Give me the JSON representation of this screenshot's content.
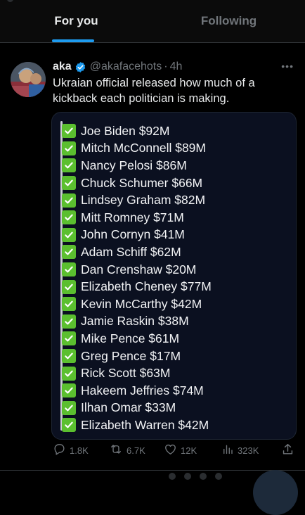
{
  "tabs": {
    "for_you": "For you",
    "following": "Following"
  },
  "tweet": {
    "display_name": "aka",
    "handle": "@akafacehots",
    "separator": "·",
    "time": "4h",
    "text": "Ukraian official released how much of a kickback each politician is making.",
    "more_label": "•••",
    "media_list": [
      "Joe Biden $92M",
      "Mitch McConnell $89M",
      "Nancy Pelosi $86M",
      "Chuck Schumer $66M",
      "Lindsey Graham $82M",
      "Mitt Romney $71M",
      "John Cornyn $41M",
      "Adam Schiff $62M",
      "Dan Crenshaw $20M",
      "Elizabeth Cheney $77M",
      "Kevin McCarthy $42M",
      "Jamie Raskin $38M",
      "Mike Pence $61M",
      "Greg Pence $17M",
      "Rick Scott $63M",
      "Hakeem Jeffries $74M",
      "Ilhan Omar $33M",
      "Elizabeth Warren $42M"
    ],
    "actions": {
      "replies": "1.8K",
      "reposts": "6.7K",
      "likes": "12K",
      "views": "323K"
    }
  },
  "icons": {
    "verified": "verified-badge-icon",
    "checkbox": "check-mark-icon",
    "reply": "reply-icon",
    "repost": "repost-icon",
    "like": "heart-icon",
    "views": "analytics-icon",
    "share": "share-icon"
  },
  "colors": {
    "accent": "#1d9bf0",
    "check": "#5bbf2f",
    "muted": "#71767b",
    "text": "#e7e9ea",
    "background": "#000000"
  }
}
